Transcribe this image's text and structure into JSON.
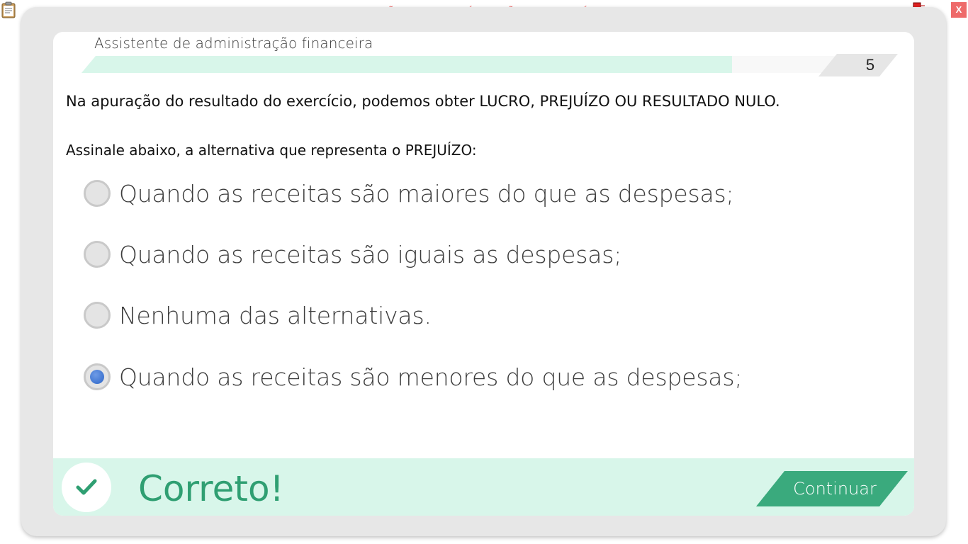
{
  "banner": {
    "watermark": "VERSÃO PARA FUNCIONÁRIOS - NÃO COMERCIALIZÁVEL"
  },
  "window": {
    "close_label": "X"
  },
  "header": {
    "course_title": "Assistente de administração financeira",
    "question_number": "5",
    "progress": 0.85
  },
  "question": {
    "text": "Na apuração do resultado do exercício, podemos obter LUCRO, PREJUÍZO OU RESULTADO NULO.",
    "instruction": "Assinale abaixo, a alternativa que representa o PREJUÍZO:",
    "options": [
      {
        "label": "Quando as receitas são maiores do que as despesas;",
        "selected": false
      },
      {
        "label": "Quando as receitas são iguais as despesas;",
        "selected": false
      },
      {
        "label": "Nenhuma das alternativas.",
        "selected": false
      },
      {
        "label": "Quando as receitas são menores do que as despesas;",
        "selected": true
      }
    ]
  },
  "feedback": {
    "result": "Correto!",
    "continue_label": "Continuar"
  },
  "colors": {
    "accent": "#3aaa7d",
    "feedback_bg": "#d8f6ea",
    "watermark": "#f06e6e",
    "radio_selected": "#2d66c8"
  },
  "icons": {
    "top_left": "clipboard-icon",
    "top_right": "network-status-icon",
    "feedback": "check-icon"
  }
}
